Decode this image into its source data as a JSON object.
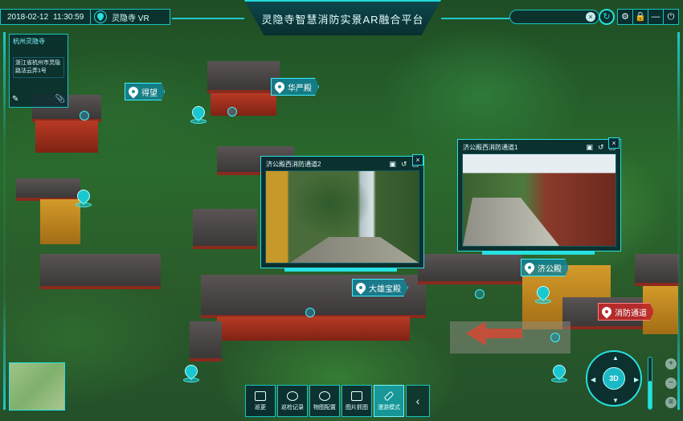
{
  "header": {
    "date": "2018-02-12",
    "time": "11:30:59",
    "location": "灵隐寺 VR",
    "title": "灵隐寺智慧消防实景AR融合平台",
    "search_clear": "×",
    "refresh_icon": "refresh-icon",
    "tools": [
      {
        "name": "settings-button",
        "icon": "gear-icon",
        "glyph": "⚙"
      },
      {
        "name": "lock-button",
        "icon": "lock-icon",
        "glyph": "🔒"
      },
      {
        "name": "minimize-button",
        "icon": "minimize-icon",
        "glyph": "—"
      },
      {
        "name": "power-button",
        "icon": "power-icon",
        "glyph": "⏻"
      }
    ]
  },
  "info_panel": {
    "title": "杭州灵隐寺",
    "subtitle": "浙江省杭州市灵隐路法云弄1号"
  },
  "poi": {
    "p1": "得望",
    "p2": "华严殿",
    "p3": "济公殿",
    "p4": "大雄宝殿",
    "p5": "消防通道"
  },
  "videos": {
    "v1": {
      "title": "济公殿西消防通道2",
      "close": "×"
    },
    "v2": {
      "title": "济公殿西消防通道1",
      "close": "×"
    }
  },
  "toolbar": {
    "items": [
      {
        "label": "巡更"
      },
      {
        "label": "巡检记录"
      },
      {
        "label": "物图配置"
      },
      {
        "label": "图片抓图"
      },
      {
        "label": "漫游模式"
      }
    ],
    "collapse": "‹"
  },
  "nav": {
    "mode": "3D",
    "zoom_level": 0.55
  },
  "colors": {
    "accent": "#27e0e0",
    "panel": "#06282f",
    "alert": "#be2828"
  }
}
